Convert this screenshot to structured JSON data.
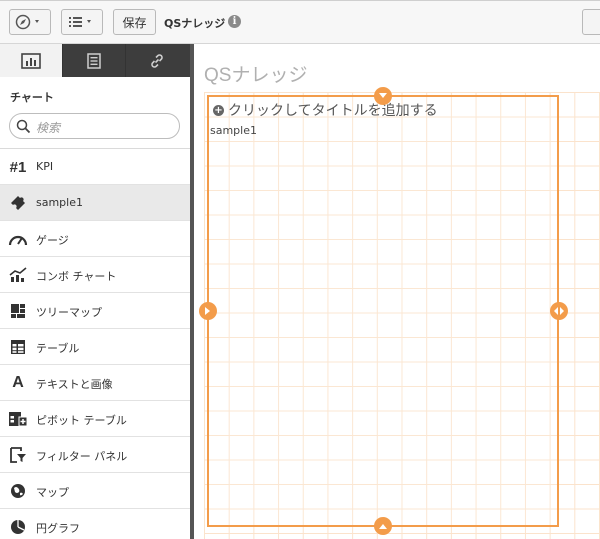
{
  "toolbar": {
    "save_label": "保存",
    "app_title": "QSナレッジ",
    "info_symbol": "i"
  },
  "panel": {
    "tabs": [
      {
        "name": "charts",
        "icon": "bar-chart-icon"
      },
      {
        "name": "fields",
        "icon": "list-icon"
      },
      {
        "name": "master-items",
        "icon": "link-icon"
      }
    ],
    "title": "チャート",
    "search_placeholder": "検索",
    "items": [
      {
        "label": "KPI",
        "icon": "kpi-icon",
        "glyph": "#1"
      },
      {
        "label": "sample1",
        "icon": "puzzle-icon"
      },
      {
        "label": "ゲージ",
        "icon": "gauge-icon"
      },
      {
        "label": "コンボ チャート",
        "icon": "combo-chart-icon"
      },
      {
        "label": "ツリーマップ",
        "icon": "treemap-icon"
      },
      {
        "label": "テーブル",
        "icon": "table-icon"
      },
      {
        "label": "テキストと画像",
        "icon": "text-image-icon",
        "glyph": "A"
      },
      {
        "label": "ピボット テーブル",
        "icon": "pivot-table-icon"
      },
      {
        "label": "フィルター パネル",
        "icon": "filter-pane-icon"
      },
      {
        "label": "マップ",
        "icon": "map-icon"
      },
      {
        "label": "円グラフ",
        "icon": "pie-chart-icon"
      }
    ],
    "selected_index": 1
  },
  "sheet": {
    "title": "QSナレッジ",
    "object": {
      "title_placeholder": "クリックしてタイトルを追加する",
      "subtitle": "sample1"
    }
  },
  "colors": {
    "accent": "#f39c4a",
    "grid": "#fbe3cc",
    "tab_bar": "#3d3d3d"
  }
}
